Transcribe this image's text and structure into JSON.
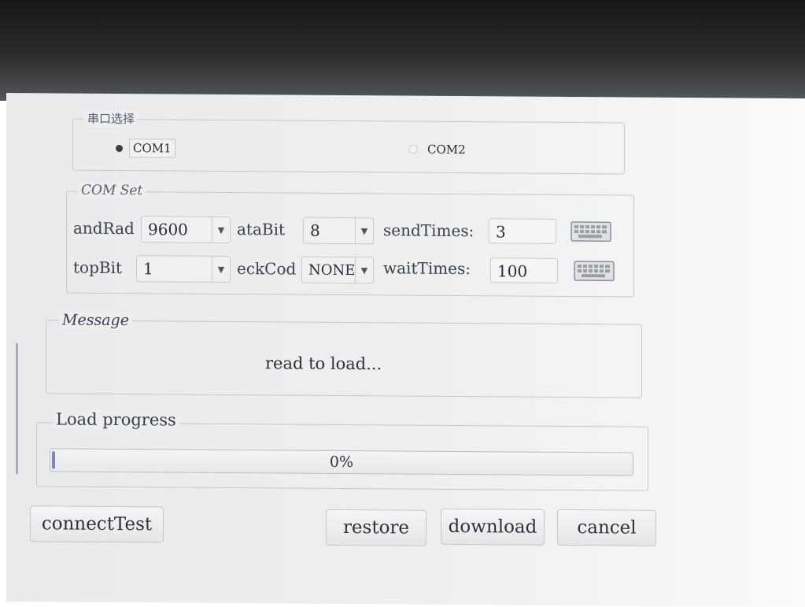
{
  "serial_select": {
    "title": "串口选择",
    "options": [
      {
        "label": "COM1",
        "selected": true
      },
      {
        "label": "COM2",
        "selected": false
      }
    ]
  },
  "com_set": {
    "title": "COM Set",
    "baud_label": "andRad",
    "baud_value": "9600",
    "databit_label": "ataBit",
    "databit_value": "8",
    "send_times_label": "sendTimes:",
    "send_times_value": "3",
    "stopbit_label": "topBit",
    "stopbit_value": "1",
    "check_label": "eckCod",
    "check_value": "NONE",
    "wait_times_label": "waitTimes:",
    "wait_times_value": "100"
  },
  "message": {
    "title": "Message",
    "text": "read to load..."
  },
  "load": {
    "title": "Load progress",
    "percent_text": "0%",
    "progress": 0
  },
  "buttons": {
    "connect_test": "connectTest",
    "restore": "restore",
    "download": "download",
    "cancel": "cancel"
  },
  "icons": {
    "keyboard": "keyboard-icon",
    "dropdown": "chevron-down-icon"
  }
}
